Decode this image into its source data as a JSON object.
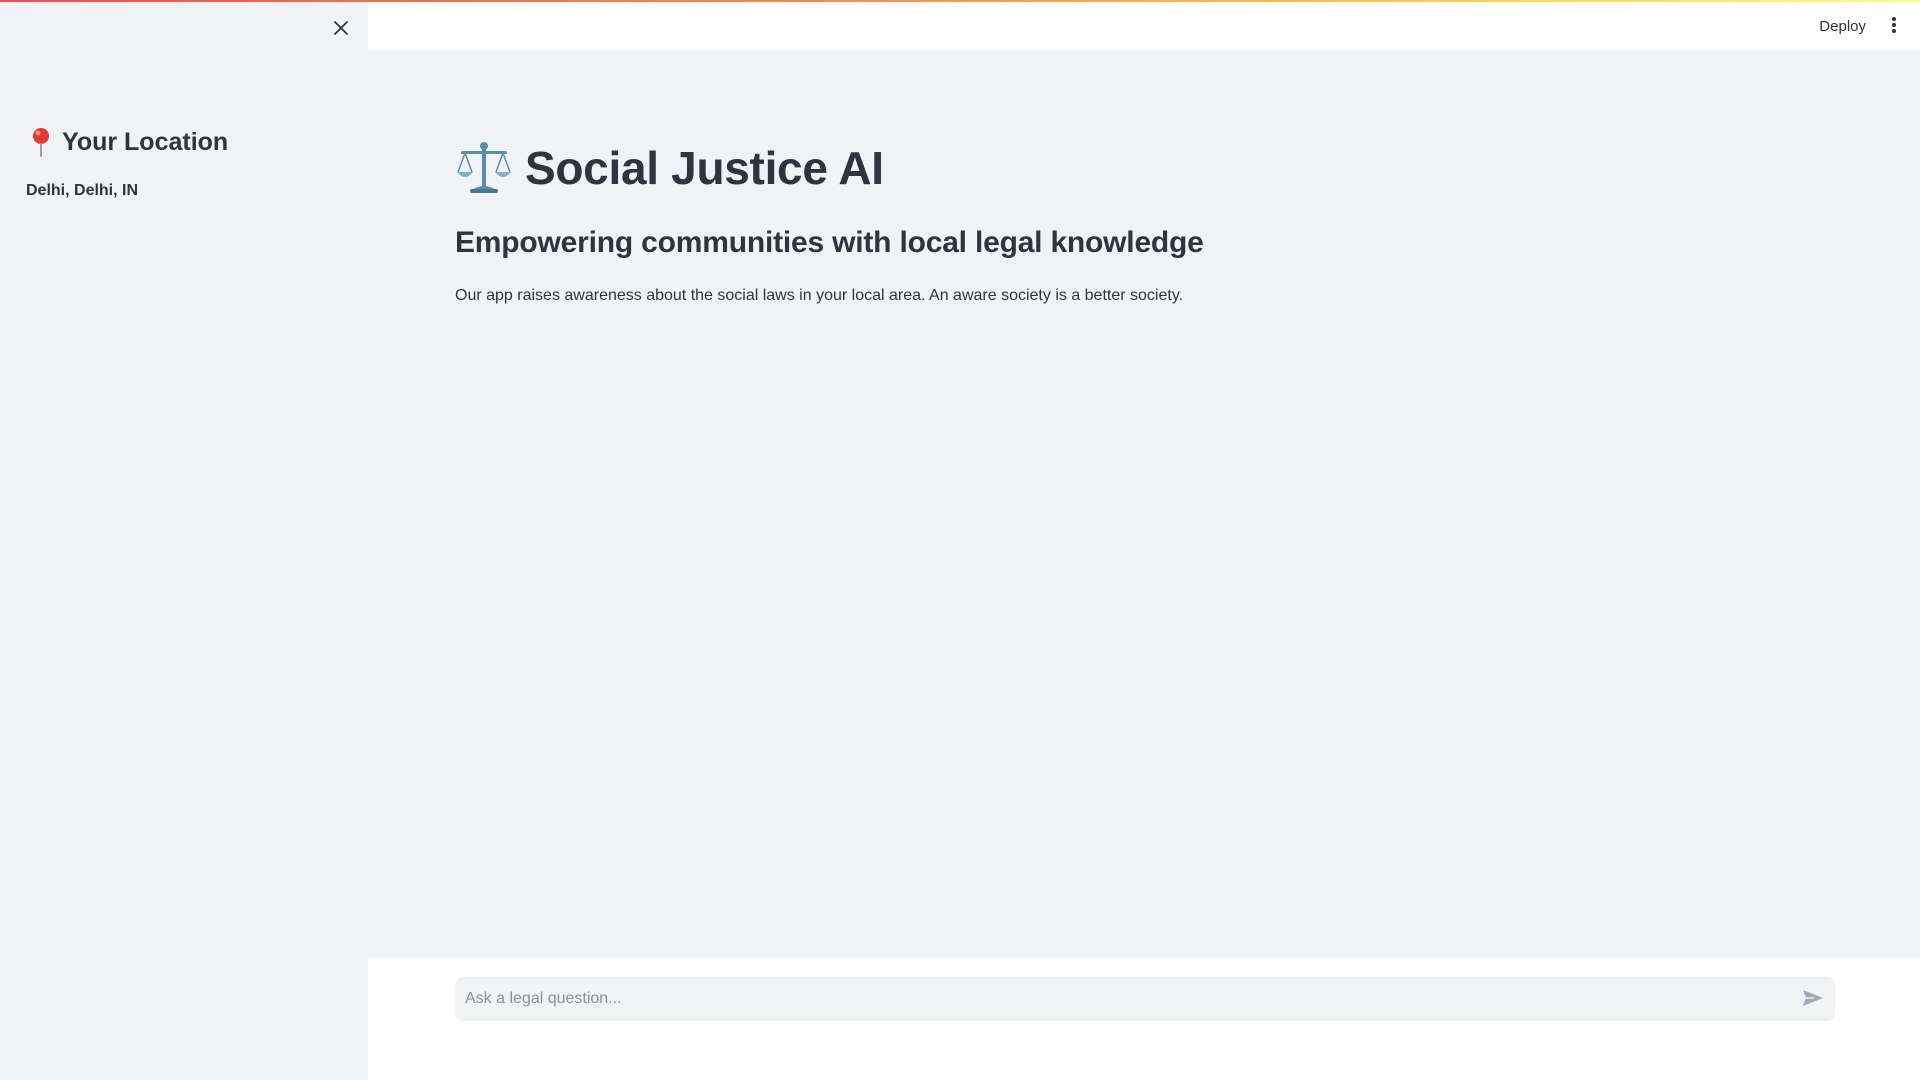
{
  "sidebar": {
    "close_icon": "close-icon",
    "heading_icon": "map-pin-icon",
    "heading": "Your Location",
    "location": "Delhi, Delhi, IN"
  },
  "header": {
    "deploy_label": "Deploy",
    "menu_icon": "vertical-dots-icon"
  },
  "main": {
    "title_icon": "balance-scale-icon",
    "title": "Social Justice AI",
    "subtitle": "Empowering communities with local legal knowledge",
    "description": "Our app raises awareness about the social laws in your local area. An aware society is a better society."
  },
  "chat": {
    "placeholder": "Ask a legal question...",
    "value": "",
    "send_icon": "send-icon"
  },
  "colors": {
    "background": "#f0f2f6",
    "text": "#31333f",
    "accent_red": "#ff4b4b",
    "accent_yellow": "#ffd84b"
  }
}
